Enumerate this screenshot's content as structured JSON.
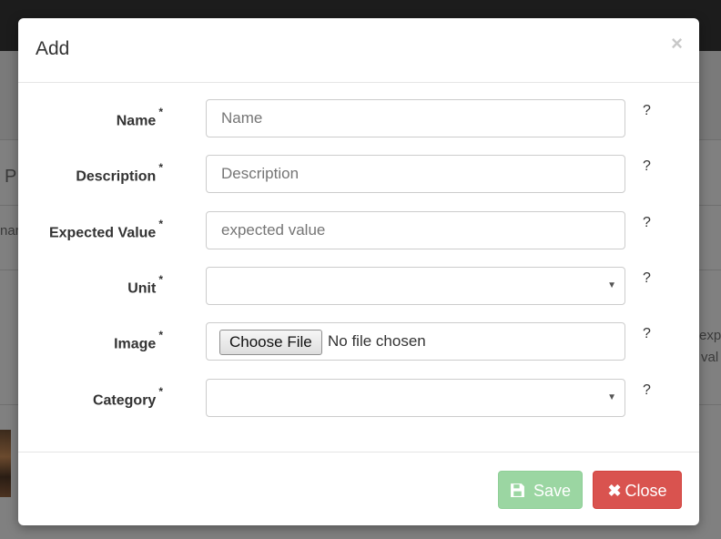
{
  "background": {
    "fragment_p": "P",
    "fragment_na": "nar",
    "fragment_expe": "expe",
    "fragment_val": "val"
  },
  "modal": {
    "title": "Add",
    "close_glyph": "×",
    "help_glyph": "?",
    "required_mark": "*",
    "fields": [
      {
        "label": "Name",
        "placeholder": "Name",
        "type": "text"
      },
      {
        "label": "Description",
        "placeholder": "Description",
        "type": "text"
      },
      {
        "label": "Expected Value",
        "placeholder": "expected value",
        "type": "text"
      },
      {
        "label": "Unit",
        "value": "",
        "type": "select"
      },
      {
        "label": "Image",
        "type": "file",
        "button_label": "Choose File",
        "status": "No file chosen"
      },
      {
        "label": "Category",
        "value": "",
        "type": "select"
      }
    ],
    "footer": {
      "save_label": "Save",
      "close_label": "Close"
    }
  },
  "colors": {
    "save": "#9bd6a2",
    "close": "#d9534f",
    "overlay": "#808080"
  }
}
